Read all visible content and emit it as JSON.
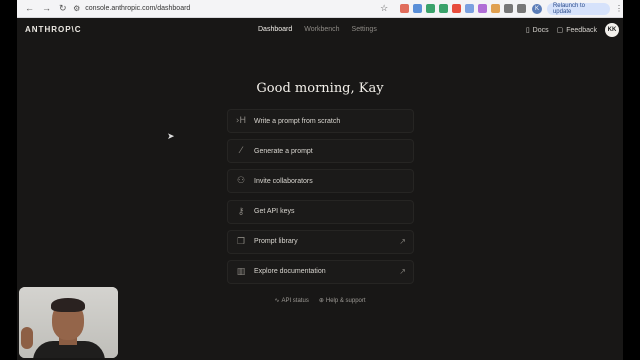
{
  "browser": {
    "url": "console.anthropic.com/dashboard",
    "relaunch_label": "Relaunch to update",
    "extension_colors": [
      "#e06c5b",
      "#5a8fd8",
      "#3aa26b",
      "#3aa26b",
      "#e74c3c",
      "#7aa0e0",
      "#b06dd6",
      "#e0a050",
      "#777777",
      "#777777"
    ]
  },
  "header": {
    "logo": "ANTHROP\\C",
    "tabs": [
      {
        "label": "Dashboard",
        "active": true
      },
      {
        "label": "Workbench",
        "active": false
      },
      {
        "label": "Settings",
        "active": false
      }
    ],
    "docs_label": "Docs",
    "feedback_label": "Feedback",
    "avatar_initials": "KK"
  },
  "main": {
    "greeting": "Good morning, Kay",
    "actions": [
      {
        "label": "Write a prompt from scratch",
        "icon": "prompt-icon",
        "external": false
      },
      {
        "label": "Generate a prompt",
        "icon": "magic-wand-icon",
        "external": false
      },
      {
        "label": "Invite collaborators",
        "icon": "people-icon",
        "external": false
      },
      {
        "label": "Get API keys",
        "icon": "key-icon",
        "external": false
      },
      {
        "label": "Prompt library",
        "icon": "library-icon",
        "external": true
      },
      {
        "label": "Explore documentation",
        "icon": "book-icon",
        "external": true
      }
    ],
    "footer": {
      "api_status": "API status",
      "help": "Help & support"
    }
  },
  "colors": {
    "background": "#181716",
    "card_border": "#262523",
    "text": "#e8e6e1"
  }
}
